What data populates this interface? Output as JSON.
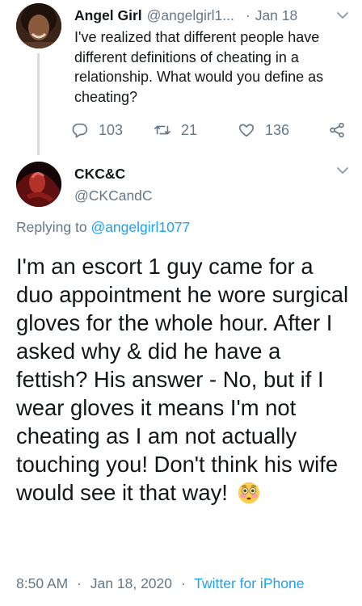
{
  "parent_tweet": {
    "display_name": "Angel Girl",
    "handle": "@angelgirl1...",
    "separator": "·",
    "date": "Jan 18",
    "text": "I've realized that different people have different definitions of cheating in a relationship. What would you define as cheating?",
    "reply_count": "103",
    "retweet_count": "21",
    "like_count": "136"
  },
  "main_tweet": {
    "display_name": "CKC&C",
    "handle": "@CKCandC",
    "replying_prefix": "Replying to",
    "replying_to": "@angelgirl1077",
    "text": "I'm an escort 1 guy came for a duo appointment he wore surgical gloves for the whole hour. After I asked why & did he have a fettish? His answer - No, but if I wear gloves it means I'm not cheating as I am not actually touching you! Don't think his wife would see it that way!",
    "emoji": "flushed-face",
    "time": "8:50 AM",
    "date": "Jan 18, 2020",
    "separator": "·",
    "source": "Twitter for iPhone"
  },
  "colors": {
    "text": "#14171a",
    "secondary": "#657786",
    "link": "#1da1f2",
    "thread_line": "#d5dadf"
  },
  "icons": [
    "reply-icon",
    "retweet-icon",
    "like-icon",
    "share-icon",
    "chevron-down-icon",
    "flushed-face-emoji"
  ]
}
